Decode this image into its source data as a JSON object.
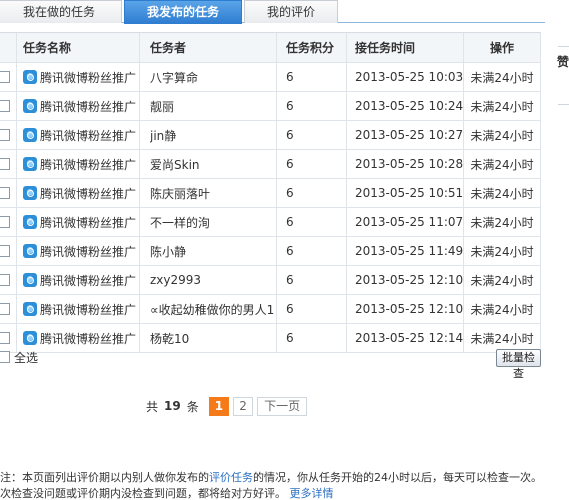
{
  "tabs": [
    {
      "label": "我在做的任务",
      "active": false
    },
    {
      "label": "我发布的任务",
      "active": true
    },
    {
      "label": "我的评价",
      "active": false
    }
  ],
  "table": {
    "headers": [
      "任务名称",
      "任务者",
      "任务积分",
      "接任务时间",
      "操作"
    ],
    "rows": [
      {
        "task": "腾讯微博粉丝推广",
        "worker": "八字算命",
        "score": "6",
        "time": "2013-05-25 10:03",
        "op": "未满24小时"
      },
      {
        "task": "腾讯微博粉丝推广",
        "worker": "靓丽",
        "score": "6",
        "time": "2013-05-25 10:24",
        "op": "未满24小时"
      },
      {
        "task": "腾讯微博粉丝推广",
        "worker": "jin静",
        "score": "6",
        "time": "2013-05-25 10:27",
        "op": "未满24小时"
      },
      {
        "task": "腾讯微博粉丝推广",
        "worker": "爱尚Skin",
        "score": "6",
        "time": "2013-05-25 10:28",
        "op": "未满24小时"
      },
      {
        "task": "腾讯微博粉丝推广",
        "worker": "陈庆丽落叶",
        "score": "6",
        "time": "2013-05-25 10:51",
        "op": "未满24小时"
      },
      {
        "task": "腾讯微博粉丝推广",
        "worker": "不一样的洵",
        "score": "6",
        "time": "2013-05-25 11:07",
        "op": "未满24小时"
      },
      {
        "task": "腾讯微博粉丝推广",
        "worker": "陈小静",
        "score": "6",
        "time": "2013-05-25 11:49",
        "op": "未满24小时"
      },
      {
        "task": "腾讯微博粉丝推广",
        "worker": "zxy2993",
        "score": "6",
        "time": "2013-05-25 12:10",
        "op": "未满24小时"
      },
      {
        "task": "腾讯微博粉丝推广",
        "worker": "∝收起幼稚做你的男人1",
        "score": "6",
        "time": "2013-05-25 12:10",
        "op": "未满24小时"
      },
      {
        "task": "腾讯微博粉丝推广",
        "worker": "杨乾10",
        "score": "6",
        "time": "2013-05-25 12:14",
        "op": "未满24小时"
      }
    ]
  },
  "select_all_label": "全选",
  "batch_check_label": "批量检查",
  "pager": {
    "prefix": "共",
    "total": "19",
    "suffix": "条",
    "pages": [
      "1",
      "2"
    ],
    "current": "1",
    "next_label": "下一页"
  },
  "note": {
    "line1_a": "注：本页面列出评价期以内别人做你发布的",
    "line1_link": "评价任务",
    "line1_b": "的情况，你从任务开始的24小时以后，每天可以检查一次。",
    "line2_a": "次检查没问题或评价期内没检查到问题，都将给对方好评。",
    "line2_link": "更多详情"
  },
  "right_partial_text": "赞",
  "icons": {
    "task_icon": "tencent-weibo-icon",
    "checkbox": "checkbox-icon"
  }
}
